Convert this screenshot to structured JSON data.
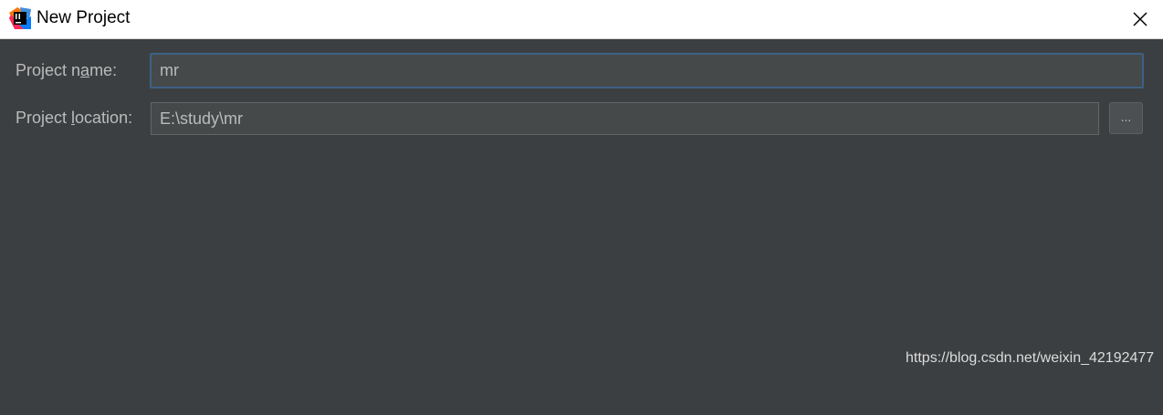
{
  "window": {
    "title": "New Project",
    "app_icon": "intellij-idea-icon",
    "close_icon": "close-icon"
  },
  "form": {
    "project_name": {
      "label_prefix": "Project n",
      "label_mnemonic": "a",
      "label_suffix": "me:",
      "value": "mr"
    },
    "project_location": {
      "label_prefix": "Project ",
      "label_mnemonic": "l",
      "label_suffix": "ocation:",
      "value": "E:\\study\\mr"
    },
    "browse_label": "..."
  },
  "watermark": "https://blog.csdn.net/weixin_42192477",
  "colors": {
    "background": "#3c3f41",
    "titlebar": "#ffffff",
    "field_bg": "#45494a",
    "focus_border": "#3d6185",
    "text": "#bbbbbb"
  }
}
